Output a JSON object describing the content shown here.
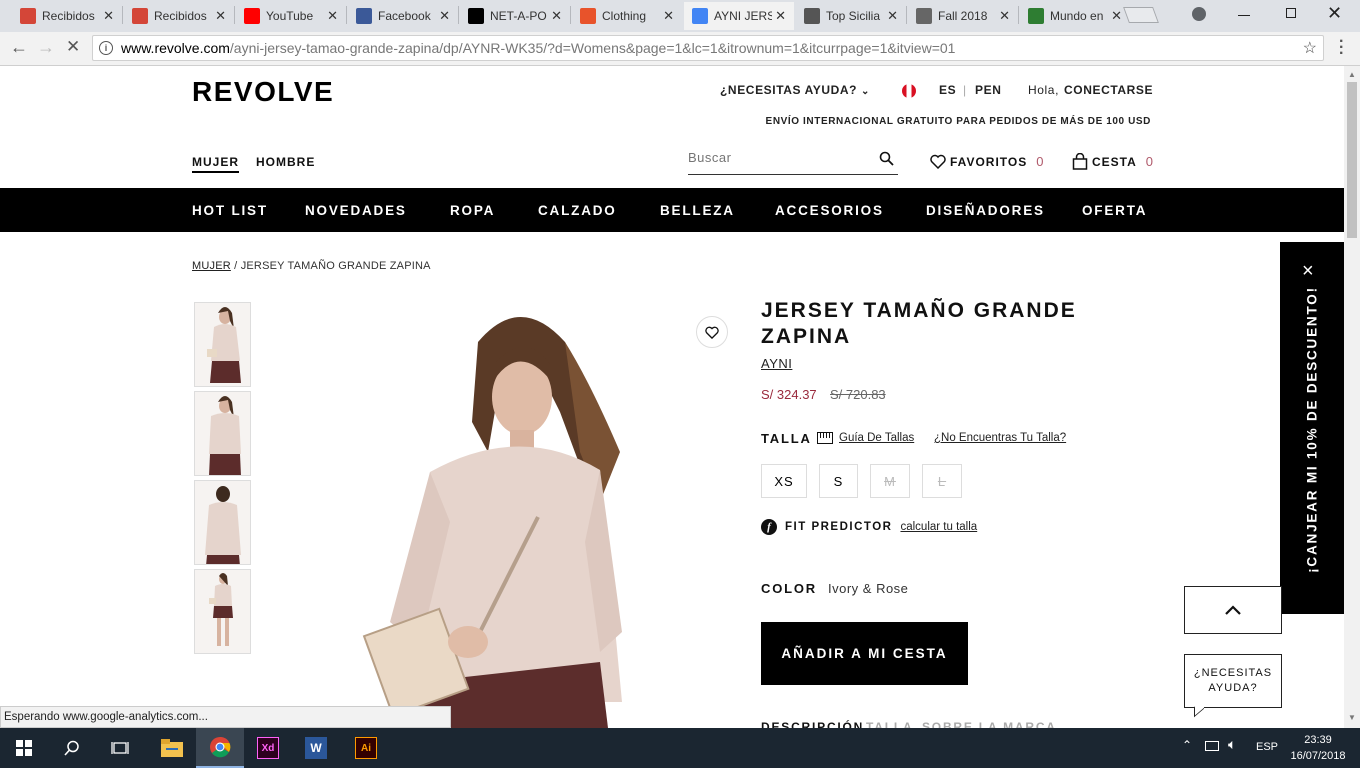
{
  "browser": {
    "tabs": [
      {
        "label": "Recibidos",
        "icon": "gmail-icon",
        "color": "#d44638"
      },
      {
        "label": "Recibidos",
        "icon": "gmail-icon",
        "color": "#d44638"
      },
      {
        "label": "YouTube",
        "icon": "youtube-icon",
        "color": "#ff0000"
      },
      {
        "label": "Facebook",
        "icon": "facebook-icon",
        "color": "#3b5998"
      },
      {
        "label": "NET-A-PO",
        "icon": "netaporter-icon",
        "color": "#000000"
      },
      {
        "label": "Clothing",
        "icon": "s-icon",
        "color": "#e8532b"
      },
      {
        "label": "AYNI JERS",
        "icon": "loading-icon",
        "color": "#4285f4"
      },
      {
        "label": "Top Sicilia",
        "icon": "tripadvisor-icon",
        "color": "#555555"
      },
      {
        "label": "Fall 2018",
        "icon": "u-icon",
        "color": "#666666"
      },
      {
        "label": "Mundo en",
        "icon": "check-icon",
        "color": "#2e7d32"
      }
    ],
    "url_host": "www.revolve.com",
    "url_path": "/ayni-jersey-tamao-grande-zapina/dp/AYNR-WK35/?d=Womens&page=1&lc=1&itrownum=1&itcurrpage=1&itview=01",
    "status_text": "Esperando www.google-analytics.com..."
  },
  "site": {
    "logo": "REVOLVE",
    "help": "¿NECESITAS AYUDA?",
    "lang": "ES",
    "currency": "PEN",
    "greeting": "Hola,",
    "login": "CONECTARSE",
    "shipping": "ENVÍO INTERNACIONAL GRATUITO PARA PEDIDOS DE MÁS DE 100 USD",
    "gender": [
      "MUJER",
      "HOMBRE"
    ],
    "search_placeholder": "Buscar",
    "favorites_label": "FAVORITOS",
    "favorites_count": "0",
    "cart_label": "CESTA",
    "cart_count": "0",
    "main_nav": [
      "HOT LIST",
      "NOVEDADES",
      "ROPA",
      "CALZADO",
      "BELLEZA",
      "ACCESORIOS",
      "DISEÑADORES",
      "OFERTA"
    ]
  },
  "breadcrumb": {
    "root": "MUJER",
    "sep": "/",
    "current": "JERSEY TAMAÑO GRANDE ZAPINA"
  },
  "product": {
    "title": "JERSEY TAMAÑO GRANDE ZAPINA",
    "brand": "AYNI",
    "price": "S/ 324.37",
    "old_price": "S/ 720.83",
    "size_label": "TALLA",
    "size_guide": "Guía De Tallas",
    "size_missing": "¿No Encuentras Tu Talla?",
    "sizes": [
      {
        "label": "XS",
        "available": true
      },
      {
        "label": "S",
        "available": true
      },
      {
        "label": "M",
        "available": false
      },
      {
        "label": "L",
        "available": false
      }
    ],
    "fit_label": "FIT PREDICTOR",
    "fit_link": "calcular tu talla",
    "color_label": "COLOR",
    "color_value": "Ivory & Rose",
    "add_to_cart": "AÑADIR A MI CESTA",
    "tabs": [
      "DESCRIPCIÓN",
      "TALLA",
      "SOBRE LA MARCA"
    ]
  },
  "promo": {
    "text": "¡CANJEAR MI 10% DE DESCUENTO!",
    "close": "×"
  },
  "help_bubble": "¿NECESITAS AYUDA?",
  "taskbar": {
    "apps": [
      "windows-icon",
      "search-icon",
      "task-view-icon",
      "file-explorer-icon",
      "chrome-icon",
      "xd-icon",
      "word-icon",
      "illustrator-icon"
    ],
    "lang": "ESP",
    "time": "23:39",
    "date": "16/07/2018"
  }
}
